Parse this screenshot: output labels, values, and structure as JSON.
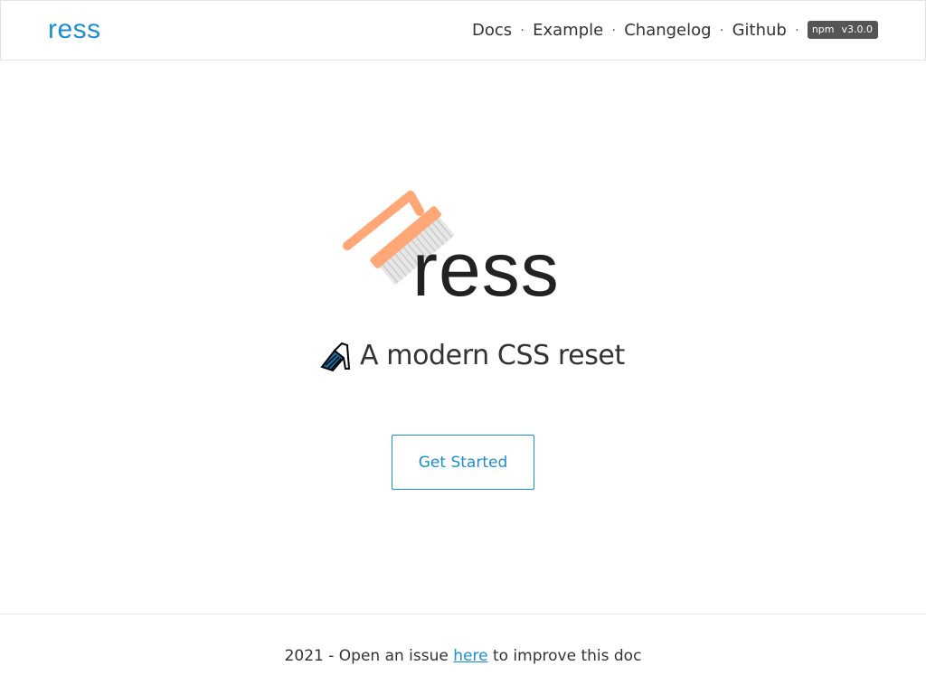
{
  "header": {
    "brand": "ress",
    "nav": [
      {
        "label": "Docs"
      },
      {
        "label": "Example"
      },
      {
        "label": "Changelog"
      },
      {
        "label": "Github"
      }
    ],
    "separator": "·",
    "badge": {
      "left": "npm",
      "right": "v3.0.0"
    }
  },
  "hero": {
    "title": "ress",
    "tagline": "A modern CSS reset",
    "logo_icon": "brush-icon",
    "tagline_icon": "paintbrush-icon",
    "cta_label": "Get Started"
  },
  "footer": {
    "prefix": "2021 - Open an issue ",
    "link": "here",
    "suffix": " to improve this doc"
  },
  "colors": {
    "accent": "#1c8fd0",
    "text": "#333333",
    "brush_orange": "#ffa776"
  }
}
